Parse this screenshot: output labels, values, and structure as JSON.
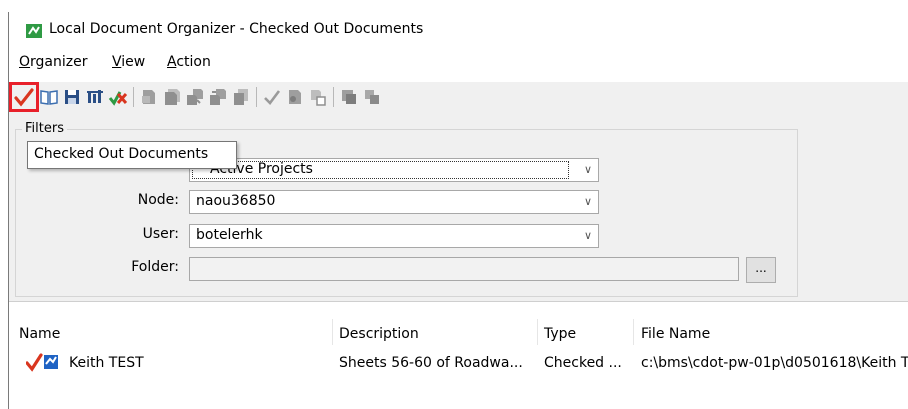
{
  "window": {
    "title": "Local Document Organizer - Checked Out Documents"
  },
  "menu": [
    {
      "label": "Organizer",
      "accel": "O",
      "rest": "rganizer"
    },
    {
      "label": "View",
      "accel": "V",
      "rest": "iew"
    },
    {
      "label": "Action",
      "accel": "A",
      "rest": "ction"
    }
  ],
  "toolbar": {
    "icons": [
      "checked-out-documents-icon",
      "book-icon",
      "save-icon",
      "properties-icon",
      "check-cross-icon",
      "document-icon",
      "document-stack-icon",
      "document-copy-icon",
      "document-export-icon",
      "document-pages-icon",
      "checkmark-icon",
      "document-refresh-icon",
      "document-link-icon",
      "document-compare-icon",
      "document-sync-icon"
    ],
    "active_color": "#e8202a"
  },
  "tooltip": {
    "text": "Checked Out Documents"
  },
  "filters": {
    "legend": "Filters",
    "project_value": "Active Projects",
    "node_label": "Node:",
    "node_value": "naou36850",
    "user_label": "User:",
    "user_value": "botelerhk",
    "folder_label": "Folder:",
    "folder_value": "",
    "browse_label": "..."
  },
  "table": {
    "columns": [
      "Name",
      "Description",
      "Type",
      "File Name"
    ],
    "rows": [
      {
        "name": "Keith TEST",
        "description": "Sheets 56-60 of Roadwa...",
        "type": "Checked ...",
        "file_name": "c:\\bms\\cdot-pw-01p\\d0501618\\Keith T"
      }
    ]
  }
}
